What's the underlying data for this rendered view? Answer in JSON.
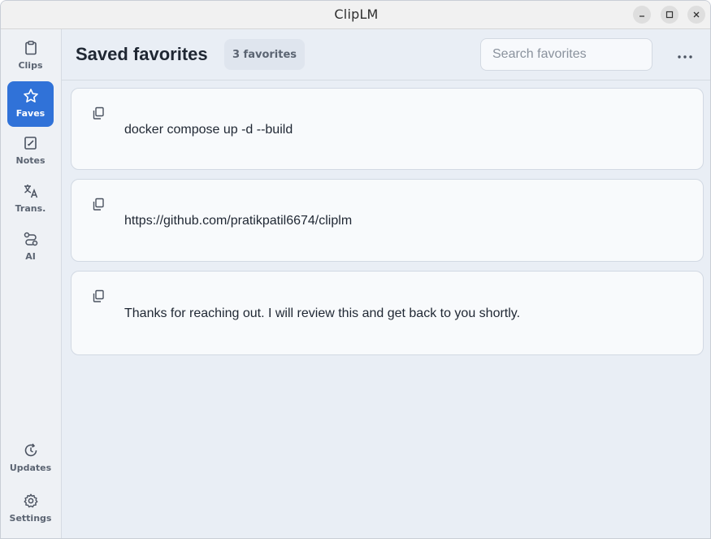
{
  "window": {
    "title": "ClipLM"
  },
  "sidebar": {
    "items": [
      {
        "label": "Clips",
        "icon": "clipboard-icon",
        "active": false
      },
      {
        "label": "Faves",
        "icon": "star-icon",
        "active": true
      },
      {
        "label": "Notes",
        "icon": "edit-note-icon",
        "active": false
      },
      {
        "label": "Trans.",
        "icon": "translate-icon",
        "active": false
      },
      {
        "label": "AI",
        "icon": "ai-route-icon",
        "active": false
      }
    ],
    "bottom_items": [
      {
        "label": "Updates",
        "icon": "update-icon"
      },
      {
        "label": "Settings",
        "icon": "gear-icon"
      }
    ]
  },
  "header": {
    "title": "Saved favorites",
    "count_badge": "3 favorites",
    "search_placeholder": "Search favorites"
  },
  "favorites": [
    {
      "text": "docker compose up -d --build"
    },
    {
      "text": "https://github.com/pratikpatil6674/cliplm"
    },
    {
      "text": "Thanks for reaching out. I will review this and get back to you shortly."
    }
  ],
  "colors": {
    "accent": "#3072d8",
    "background": "#e9eef5",
    "card": "#f8fafc"
  }
}
